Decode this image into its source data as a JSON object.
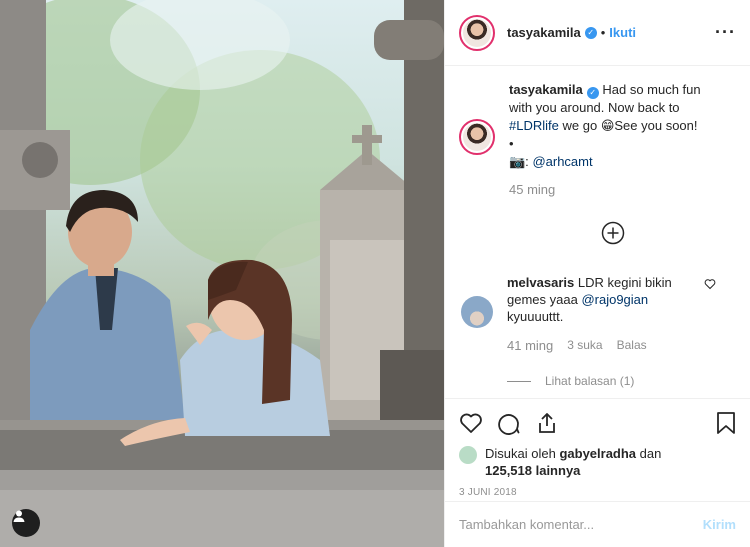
{
  "post": {
    "username": "tasyakamila",
    "follow_label": "Ikuti",
    "more_icon": "more-horizontal-icon",
    "caption_username": "tasyakamila",
    "caption_text": "Had so much fun with you around. Now back to",
    "caption_hashtag": "#LDRlife",
    "caption_after": "we go",
    "caption_emoji": "😁",
    "caption_end": "See you soon!",
    "caption_bullet": "•",
    "caption_camera": "📷:",
    "caption_mention": "@arhcamt",
    "caption_time": "45 ming"
  },
  "comment": {
    "username": "melvasaris",
    "text": "LDR kegini bikin gemes yaaa",
    "mention": "@rajo9gian",
    "text_end": "kyuuuuttt.",
    "time": "41 ming",
    "likes": "3 suka",
    "reply": "Balas",
    "view_replies": "Lihat balasan (1)"
  },
  "likes": {
    "prefix": "Disukai oleh",
    "user": "gabyelradha",
    "and": "dan",
    "count": "125,518 lainnya"
  },
  "date": "3 JUNI 2018",
  "add_comment": {
    "placeholder": "Tambahkan komentar...",
    "send_label": "Kirim"
  },
  "colors": {
    "accent": "#3897f0",
    "link": "#003569",
    "muted": "#8e8e8e"
  }
}
